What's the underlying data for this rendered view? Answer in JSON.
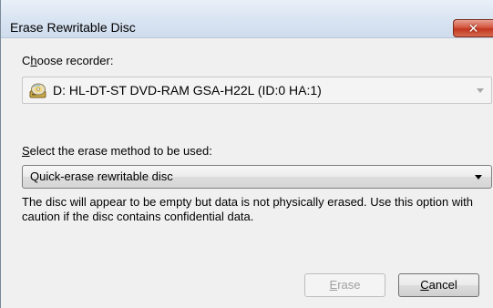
{
  "window": {
    "title": "Erase Rewritable Disc",
    "close_glyph": "✕"
  },
  "recorder": {
    "label_prefix": "C",
    "label_accel": "h",
    "label_rest": "oose recorder:",
    "selected": "D: HL-DT-ST DVD-RAM GSA-H22L (ID:0 HA:1)",
    "icon": "disc-drive-icon",
    "enabled": false
  },
  "method": {
    "label_accel": "S",
    "label_rest": "elect the erase method to be used:",
    "selected": "Quick-erase rewritable disc"
  },
  "description": "The disc will appear to be empty but data is not physically erased. Use this option with caution if the disc contains confidential data.",
  "buttons": {
    "erase_accel": "E",
    "erase_rest": "rase",
    "erase_enabled": false,
    "cancel_accel": "C",
    "cancel_rest": "ancel"
  },
  "colors": {
    "dialog_bg": "#f0f0f0",
    "close_button": "#c2361f",
    "disabled_text": "#a0a0a0"
  }
}
